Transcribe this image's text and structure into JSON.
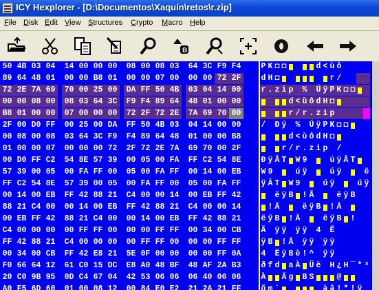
{
  "window": {
    "title": "ICY Hexplorer - [D:\\Documentos\\Xaquín\\retos\\r.zip]"
  },
  "menu": [
    {
      "label": "File",
      "u": "F"
    },
    {
      "label": "Disk",
      "u": "D"
    },
    {
      "label": "Edit",
      "u": "E"
    },
    {
      "label": "View",
      "u": "V"
    },
    {
      "label": "Structures",
      "u": "S"
    },
    {
      "label": "Crypto",
      "u": "C"
    },
    {
      "label": "Macro",
      "u": "M"
    },
    {
      "label": "Help",
      "u": "H"
    }
  ],
  "toolbar": [
    {
      "name": "open-file-icon"
    },
    {
      "name": "cut-icon"
    },
    {
      "name": "copy-icon"
    },
    {
      "name": "paste-icon"
    },
    {
      "name": "find-icon"
    },
    {
      "name": "replace-icon"
    },
    {
      "name": "find-next-icon"
    },
    {
      "name": "goto-offset-icon"
    },
    {
      "name": "bookmark-icon"
    },
    {
      "name": "back-arrow-icon"
    },
    {
      "name": "forward-arrow-icon"
    }
  ],
  "hex_rows": [
    [
      "50",
      "4B",
      "03",
      "04",
      "14",
      "00",
      "00",
      "00",
      "08",
      "00",
      "08",
      "03",
      "64",
      "3C",
      "F9",
      "F4"
    ],
    [
      "89",
      "64",
      "48",
      "01",
      "00",
      "00",
      "B8",
      "01",
      "00",
      "00",
      "07",
      "00",
      "00",
      "00",
      "72",
      "2F"
    ],
    [
      "72",
      "2E",
      "7A",
      "69",
      "70",
      "00",
      "25",
      "00",
      "DA",
      "FF",
      "50",
      "4B",
      "03",
      "04",
      "14",
      "00"
    ],
    [
      "00",
      "00",
      "08",
      "00",
      "08",
      "03",
      "64",
      "3C",
      "F9",
      "F4",
      "89",
      "64",
      "48",
      "01",
      "00",
      "00"
    ],
    [
      "B8",
      "01",
      "00",
      "00",
      "07",
      "00",
      "00",
      "00",
      "72",
      "2F",
      "72",
      "2E",
      "7A",
      "69",
      "70",
      "00"
    ],
    [
      "2F",
      "00",
      "D0",
      "FF",
      "00",
      "25",
      "00",
      "DA",
      "FF",
      "50",
      "4B",
      "03",
      "04",
      "14",
      "00",
      "00"
    ],
    [
      "00",
      "08",
      "00",
      "08",
      "03",
      "64",
      "3C",
      "F9",
      "F4",
      "89",
      "64",
      "48",
      "01",
      "00",
      "00",
      "B8"
    ],
    [
      "01",
      "00",
      "00",
      "07",
      "00",
      "00",
      "00",
      "72",
      "2F",
      "72",
      "2E",
      "7A",
      "69",
      "70",
      "00",
      "2F"
    ],
    [
      "00",
      "D0",
      "FF",
      "C2",
      "54",
      "8E",
      "57",
      "39",
      "00",
      "05",
      "00",
      "FA",
      "FF",
      "C2",
      "54",
      "8E"
    ],
    [
      "57",
      "39",
      "00",
      "05",
      "00",
      "FA",
      "FF",
      "00",
      "05",
      "00",
      "FA",
      "FF",
      "00",
      "14",
      "00",
      "EB"
    ],
    [
      "FF",
      "C2",
      "54",
      "8E",
      "57",
      "39",
      "00",
      "05",
      "00",
      "FA",
      "FF",
      "00",
      "05",
      "00",
      "FA",
      "FF"
    ],
    [
      "00",
      "14",
      "00",
      "EB",
      "FF",
      "42",
      "88",
      "21",
      "C4",
      "00",
      "00",
      "14",
      "00",
      "EB",
      "FF",
      "42"
    ],
    [
      "88",
      "21",
      "C4",
      "00",
      "00",
      "14",
      "00",
      "EB",
      "FF",
      "42",
      "88",
      "21",
      "C4",
      "00",
      "00",
      "14"
    ],
    [
      "00",
      "EB",
      "FF",
      "42",
      "88",
      "21",
      "C4",
      "00",
      "00",
      "14",
      "00",
      "EB",
      "FF",
      "42",
      "88",
      "21"
    ],
    [
      "C4",
      "00",
      "00",
      "00",
      "00",
      "FF",
      "FF",
      "00",
      "00",
      "00",
      "FF",
      "FF",
      "00",
      "34",
      "00",
      "CB"
    ],
    [
      "FF",
      "42",
      "88",
      "21",
      "C4",
      "00",
      "00",
      "00",
      "00",
      "FF",
      "FF",
      "00",
      "00",
      "00",
      "FF",
      "FF"
    ],
    [
      "00",
      "34",
      "00",
      "CB",
      "FF",
      "42",
      "E8",
      "21",
      "5E",
      "0F",
      "00",
      "00",
      "00",
      "00",
      "FF",
      "0A"
    ],
    [
      "F0",
      "66",
      "64",
      "12",
      "61",
      "C0",
      "15",
      "DC",
      "E8",
      "A0",
      "48",
      "BF",
      "48",
      "AF",
      "2A",
      "B3"
    ],
    [
      "20",
      "C0",
      "9B",
      "95",
      "0D",
      "C4",
      "67",
      "04",
      "42",
      "53",
      "06",
      "06",
      "06",
      "40",
      "06",
      "06"
    ],
    [
      "A0",
      "F5",
      "6D",
      "60",
      "01",
      "00",
      "08",
      "12",
      "00",
      "84",
      "E0",
      "E2",
      "21",
      "2A",
      "21",
      "FF"
    ]
  ],
  "selection_start": 30,
  "selection_end": 79,
  "cursor_index": 79,
  "ascii_rows": [
    "PK◘◘▮ ▮▮d<ùô",
    "dH◘▮ ▮▮▮ ▮r/",
    "r.zip % ÚÿPK◘◘▮",
    "▮ ▮▮d<ùôdH◘▮",
    "▮ ▮▮r/r.zip",
    "/ Ðÿ % ÚÿPK◘◘▮",
    "▮ ▮▮d<ùôdH◘▮",
    "▮ ▮r/r.zip /",
    "ÐÿÂT▮W9 ▮ úÿÂT▮",
    "W9 ▮ úÿ ▮ úÿ ▮ ë",
    "ÿÂT▮W9 ▮ úÿ ▮ úÿ",
    "▮ ëÿB▮!Ä ▮ ëÿB",
    "▮!Ä ▮ ëÿB▮!Ä ▮",
    "ëÿB▮!Ä ▮ ëÿB▮!",
    "Ä ÿÿ ÿÿ 4 Ë",
    "ÿB▮!Ä ÿÿ ÿÿ",
    "4 ËÿBè!^ ÿÿ",
    "ðfd▮aÀ▮Üè H¿H¯*³",
    "À▮▮Äg▮BS▮▮▮@▮▮",
    "õm`▮ ▮▮▮ àâ!*!ÿ"
  ]
}
